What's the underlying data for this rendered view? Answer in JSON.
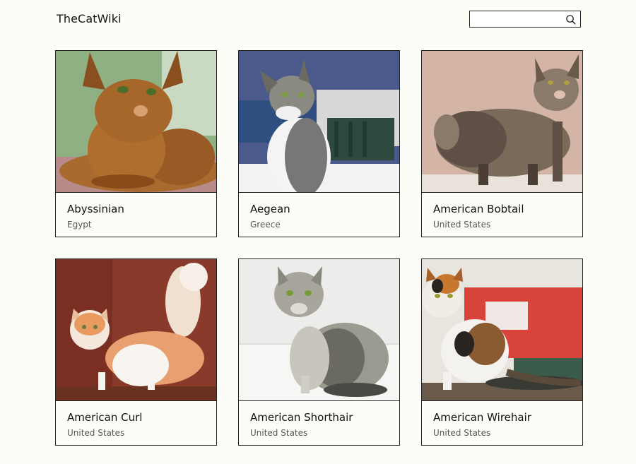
{
  "header": {
    "brand": "TheCatWiki",
    "search": {
      "value": "",
      "placeholder": ""
    }
  },
  "cats": [
    {
      "name": "Abyssinian",
      "origin": "Egypt"
    },
    {
      "name": "Aegean",
      "origin": "Greece"
    },
    {
      "name": "American Bobtail",
      "origin": "United States"
    },
    {
      "name": "American Curl",
      "origin": "United States"
    },
    {
      "name": "American Shorthair",
      "origin": "United States"
    },
    {
      "name": "American Wirehair",
      "origin": "United States"
    }
  ],
  "icons": {
    "search": "search-icon"
  },
  "colors": {
    "background": "#fdfdf8",
    "border": "#222222",
    "text": "#111111",
    "muted": "#555555"
  }
}
